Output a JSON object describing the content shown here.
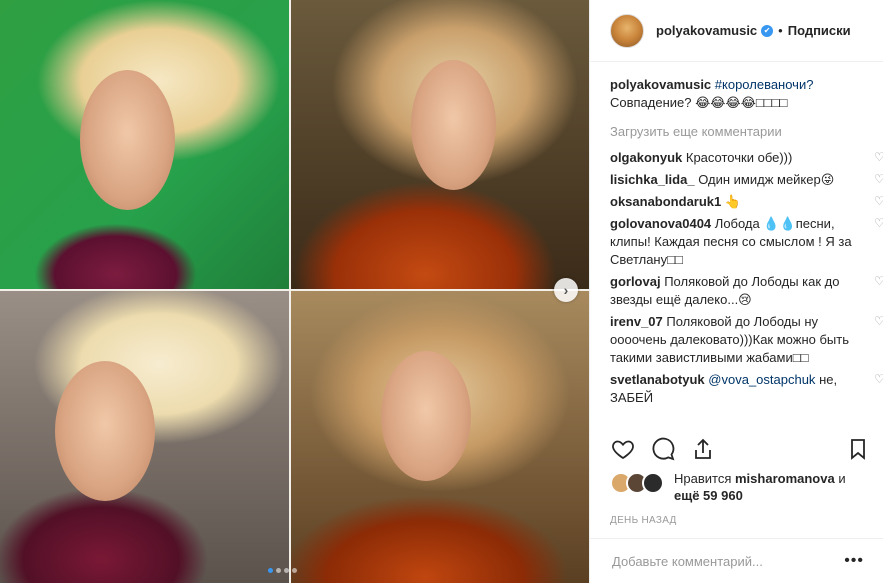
{
  "header": {
    "username": "polyakovamusic",
    "verified_glyph": "✔",
    "separator": "•",
    "follow_label": "Подписки"
  },
  "caption": {
    "username": "polyakovamusic",
    "hashtag": "#королеваночи?",
    "text": "Совпадение? 😂😂😂😂□□□□"
  },
  "load_more_label": "Загрузить еще комментарии",
  "comments": [
    {
      "user": "olgakonyuk",
      "text": "Красоточки обе)))"
    },
    {
      "user": "lisichka_lida_",
      "text": "Один имидж мейкер😜"
    },
    {
      "user": "oksanabondaruk1",
      "text": "👆"
    },
    {
      "user": "golovanova0404",
      "text": "Лобода 💧💧песни, клипы! Каждая песня со смыслом ! Я за Светлану□□"
    },
    {
      "user": "gorlovaj",
      "text": "Поляковой до Лободы как до звезды ещё далеко...😢"
    },
    {
      "user": "irenv_07",
      "text": "Поляковой до Лободы ну оооочень далековато)))Как можно быть такими завистливыми жабами□□"
    },
    {
      "user": "svetlanabotyuk",
      "mention": "@vova_ostapchuk",
      "text": "не, ЗАБЕЙ"
    }
  ],
  "likes": {
    "prefix": "Нравится",
    "user": "misharomanova",
    "middle": "и",
    "rest": "ещё 59 960"
  },
  "date": "ДЕНЬ НАЗАД",
  "add_comment": {
    "placeholder": "Добавьте комментарий...",
    "more_glyph": "•••"
  },
  "carousel": {
    "next_glyph": "›",
    "slide_count": 4,
    "active_slide": 1
  },
  "colors": {
    "accent": "#3897f0",
    "link": "#003569",
    "muted": "#999999"
  },
  "icons": [
    "heart-icon",
    "comment-icon",
    "share-icon",
    "bookmark-icon",
    "verified-icon",
    "chevron-right-icon"
  ]
}
